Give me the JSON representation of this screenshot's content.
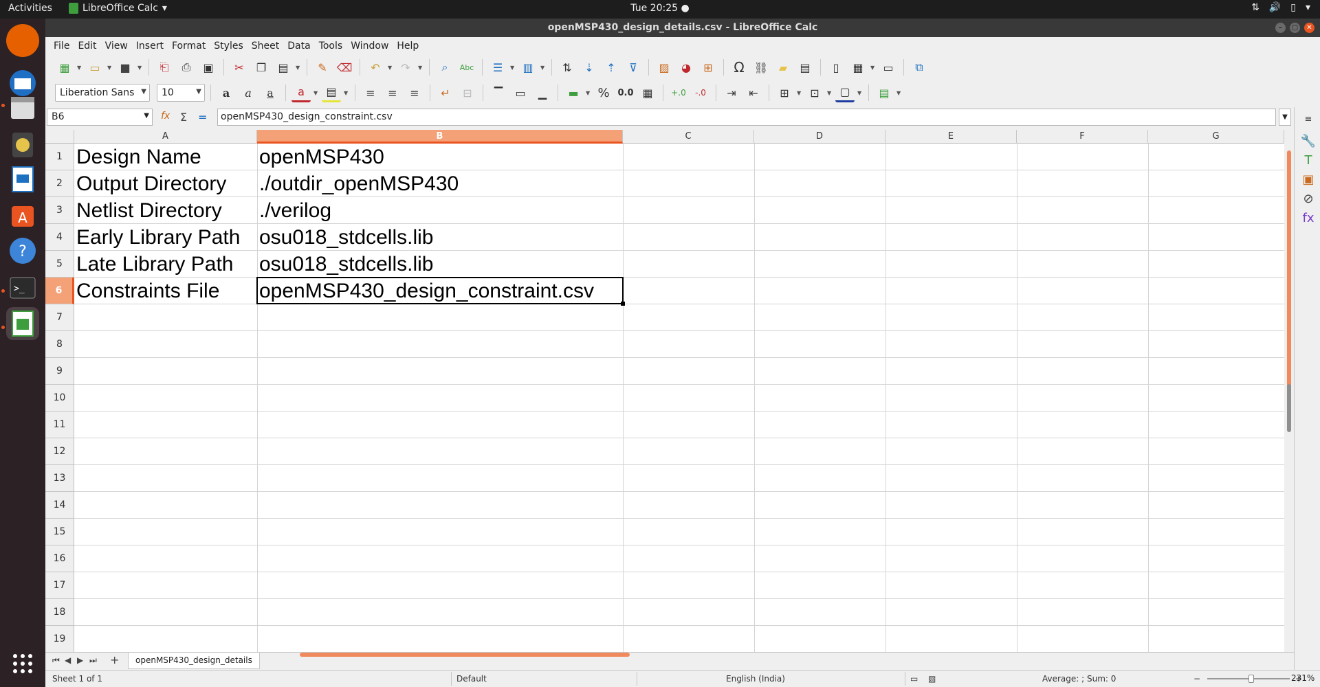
{
  "topbar": {
    "activities": "Activities",
    "app_name": "LibreOffice Calc",
    "clock": "Tue 20:25"
  },
  "window": {
    "title": "openMSP430_design_details.csv - LibreOffice Calc"
  },
  "menu": [
    "File",
    "Edit",
    "View",
    "Insert",
    "Format",
    "Styles",
    "Sheet",
    "Data",
    "Tools",
    "Window",
    "Help"
  ],
  "format_toolbar": {
    "font_name": "Liberation Sans",
    "font_size": "10"
  },
  "formula_bar": {
    "name_box": "B6",
    "content": "openMSP430_design_constraint.csv"
  },
  "columns": [
    "A",
    "B",
    "C",
    "D",
    "E",
    "F",
    "G"
  ],
  "selected_column": "B",
  "rows": [
    "1",
    "2",
    "3",
    "4",
    "5",
    "6",
    "7",
    "8",
    "9",
    "10",
    "11",
    "12",
    "13",
    "14",
    "15",
    "16",
    "17",
    "18",
    "19"
  ],
  "selected_row": "6",
  "cells": [
    {
      "a": "Design Name",
      "b": "openMSP430"
    },
    {
      "a": "Output Directory",
      "b": "./outdir_openMSP430"
    },
    {
      "a": "Netlist Directory",
      "b": "./verilog"
    },
    {
      "a": "Early Library Path",
      "b": "osu018_stdcells.lib"
    },
    {
      "a": "Late Library Path",
      "b": "osu018_stdcells.lib"
    },
    {
      "a": "Constraints File",
      "b": "openMSP430_design_constraint.csv"
    }
  ],
  "sheet_tab": "openMSP430_design_details",
  "status": {
    "sheet": "Sheet 1 of 1",
    "style": "Default",
    "language": "English (India)",
    "summary": "Average: ; Sum: 0",
    "zoom": "231%"
  },
  "colors": {
    "accent": "#e95420",
    "selected_header": "#f5a178"
  }
}
